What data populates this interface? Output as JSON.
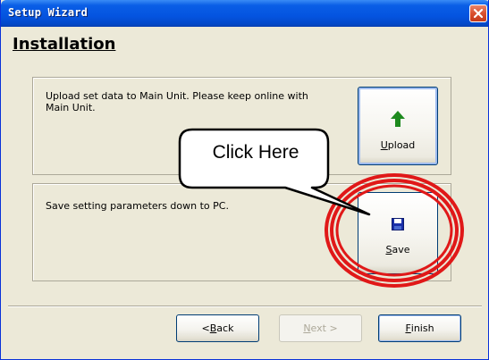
{
  "window": {
    "title": "Setup Wizard"
  },
  "header": {
    "title": "Installation"
  },
  "panels": [
    {
      "description": "Upload set data to Main Unit. Please keep online with Main Unit.",
      "button": {
        "label_rest": "pload",
        "label_key": "U",
        "icon": "green-up-arrow-icon"
      }
    },
    {
      "description": "Save setting parameters down to PC.",
      "button": {
        "label_rest": "ave",
        "label_key": "S",
        "icon": "floppy-disk-icon"
      }
    }
  ],
  "callout": {
    "text": "Click Here"
  },
  "footer": {
    "back": {
      "prefix": "< ",
      "key": "B",
      "rest": "ack"
    },
    "next": {
      "key": "N",
      "rest": "ext >"
    },
    "finish": {
      "key": "F",
      "rest": "inish"
    }
  },
  "colors": {
    "highlight_ring": "#e01818",
    "titlebar": "#0454e0",
    "upload_arrow": "#1e8a1e",
    "floppy": "#1a2fa8"
  }
}
